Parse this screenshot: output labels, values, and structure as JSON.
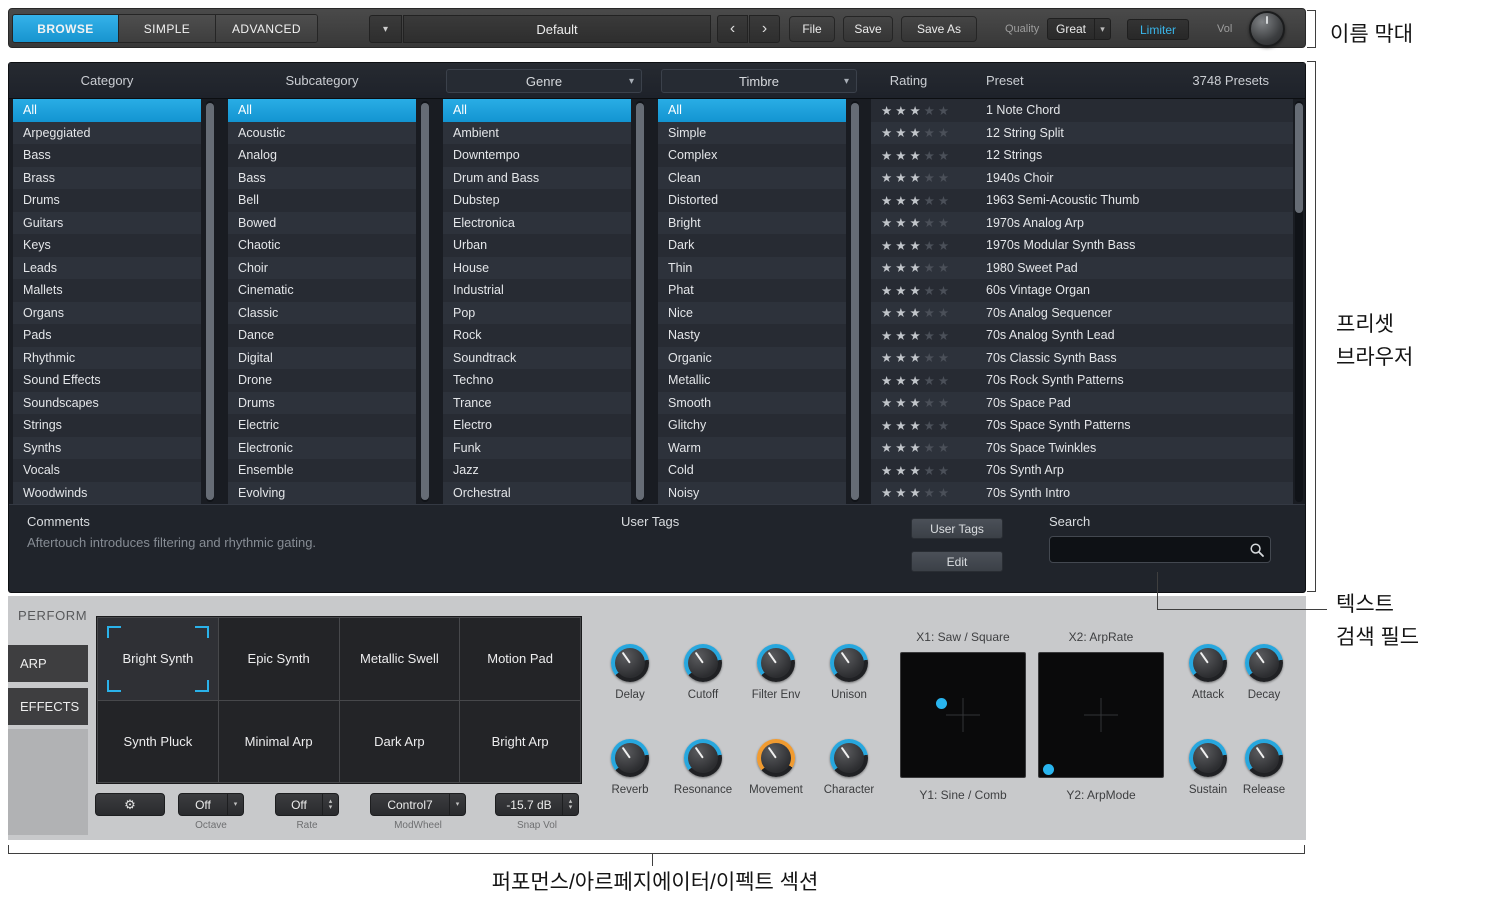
{
  "icons": {
    "chevron_down": "▾",
    "prev": "‹",
    "next": "›",
    "gear": "⚙",
    "star": "★",
    "step_up": "▴",
    "step_down": "▾"
  },
  "colors": {
    "accent": "#23a8e0",
    "movement_accent": "#f19b30",
    "selected_row": "#1ba0d8"
  },
  "topbar": {
    "tabs": [
      {
        "label": "BROWSE",
        "active": true
      },
      {
        "label": "SIMPLE",
        "active": false
      },
      {
        "label": "ADVANCED",
        "active": false
      }
    ],
    "preset_name": "Default",
    "file_button": "File",
    "save_button": "Save",
    "save_as_button": "Save As",
    "quality_label": "Quality",
    "quality_value": "Great",
    "limiter_button": "Limiter",
    "vol_label": "Vol"
  },
  "browser": {
    "headers": {
      "category": "Category",
      "subcategory": "Subcategory",
      "genre": "Genre",
      "timbre": "Timbre",
      "rating": "Rating",
      "preset": "Preset",
      "count": "3748 Presets"
    },
    "selected": {
      "category": "All",
      "subcategory": "All",
      "genre": "All",
      "timbre": "All"
    },
    "categories": [
      "All",
      "Arpeggiated",
      "Bass",
      "Brass",
      "Drums",
      "Guitars",
      "Keys",
      "Leads",
      "Mallets",
      "Organs",
      "Pads",
      "Rhythmic",
      "Sound Effects",
      "Soundscapes",
      "Strings",
      "Synths",
      "Vocals",
      "Woodwinds"
    ],
    "subcategories": [
      "All",
      "Acoustic",
      "Analog",
      "Bass",
      "Bell",
      "Bowed",
      "Chaotic",
      "Choir",
      "Cinematic",
      "Classic",
      "Dance",
      "Digital",
      "Drone",
      "Drums",
      "Electric",
      "Electronic",
      "Ensemble",
      "Evolving"
    ],
    "genres": [
      "All",
      "Ambient",
      "Downtempo",
      "Drum and Bass",
      "Dubstep",
      "Electronica",
      "Urban",
      "House",
      "Industrial",
      "Pop",
      "Rock",
      "Soundtrack",
      "Techno",
      "Trance",
      "Electro",
      "Funk",
      "Jazz",
      "Orchestral"
    ],
    "timbres": [
      "All",
      "Simple",
      "Complex",
      "Clean",
      "Distorted",
      "Bright",
      "Dark",
      "Thin",
      "Phat",
      "Nice",
      "Nasty",
      "Organic",
      "Metallic",
      "Smooth",
      "Glitchy",
      "Warm",
      "Cold",
      "Noisy"
    ],
    "presets": [
      {
        "name": "1 Note Chord",
        "rating": 3
      },
      {
        "name": "12 String Split",
        "rating": 3
      },
      {
        "name": "12 Strings",
        "rating": 3
      },
      {
        "name": "1940s Choir",
        "rating": 3
      },
      {
        "name": "1963 Semi-Acoustic Thumb",
        "rating": 3
      },
      {
        "name": "1970s Analog Arp",
        "rating": 3
      },
      {
        "name": "1970s Modular Synth Bass",
        "rating": 3
      },
      {
        "name": "1980 Sweet Pad",
        "rating": 3
      },
      {
        "name": "60s Vintage Organ",
        "rating": 3
      },
      {
        "name": "70s Analog Sequencer",
        "rating": 3
      },
      {
        "name": "70s Analog Synth Lead",
        "rating": 3
      },
      {
        "name": "70s Classic Synth Bass",
        "rating": 3
      },
      {
        "name": "70s Rock Synth Patterns",
        "rating": 3
      },
      {
        "name": "70s Space Pad",
        "rating": 3
      },
      {
        "name": "70s Space Synth Patterns",
        "rating": 3
      },
      {
        "name": "70s Space Twinkles",
        "rating": 3
      },
      {
        "name": "70s Synth Arp",
        "rating": 3
      },
      {
        "name": "70s Synth Intro",
        "rating": 3
      }
    ]
  },
  "comments": {
    "label": "Comments",
    "text": "Aftertouch introduces filtering and rhythmic gating.",
    "user_tags_label": "User Tags",
    "user_tags_button": "User Tags",
    "edit_button": "Edit"
  },
  "search": {
    "label": "Search",
    "value": ""
  },
  "perform": {
    "tabs": [
      "PERFORM",
      "ARP",
      "EFFECTS"
    ],
    "active_tab": "PERFORM",
    "pads": [
      "Bright Synth",
      "Epic Synth",
      "Metallic Swell",
      "Motion Pad",
      "Synth Pluck",
      "Minimal Arp",
      "Dark Arp",
      "Bright Arp"
    ],
    "selected_pad": "Bright Synth",
    "controls": [
      {
        "value": "Off",
        "label": "Octave",
        "type": "dropdown"
      },
      {
        "value": "Off",
        "label": "Rate",
        "type": "stepper"
      },
      {
        "value": "Control7",
        "label": "ModWheel",
        "type": "dropdown"
      },
      {
        "value": "-15.7 dB",
        "label": "Snap Vol",
        "type": "stepper"
      }
    ],
    "knob_row1": [
      "Delay",
      "Cutoff",
      "Filter Env",
      "Unison"
    ],
    "knob_row2": [
      "Reverb",
      "Resonance",
      "Movement",
      "Character"
    ],
    "env_row1": [
      "Attack",
      "Decay"
    ],
    "env_row2": [
      "Sustain",
      "Release"
    ],
    "xy1": {
      "x_label": "X1: Saw / Square",
      "y_label": "Y1: Sine / Comb"
    },
    "xy2": {
      "x_label": "X2: ArpRate",
      "y_label": "Y2: ArpMode"
    }
  },
  "annotations": {
    "name_bar": "이름 막대",
    "preset_browser_line1": "프리셋",
    "preset_browser_line2": "브라우저",
    "search_line1": "텍스트",
    "search_line2": "검색 필드",
    "bottom_section": "퍼포먼스/아르페지에이터/이펙트 섹션"
  }
}
